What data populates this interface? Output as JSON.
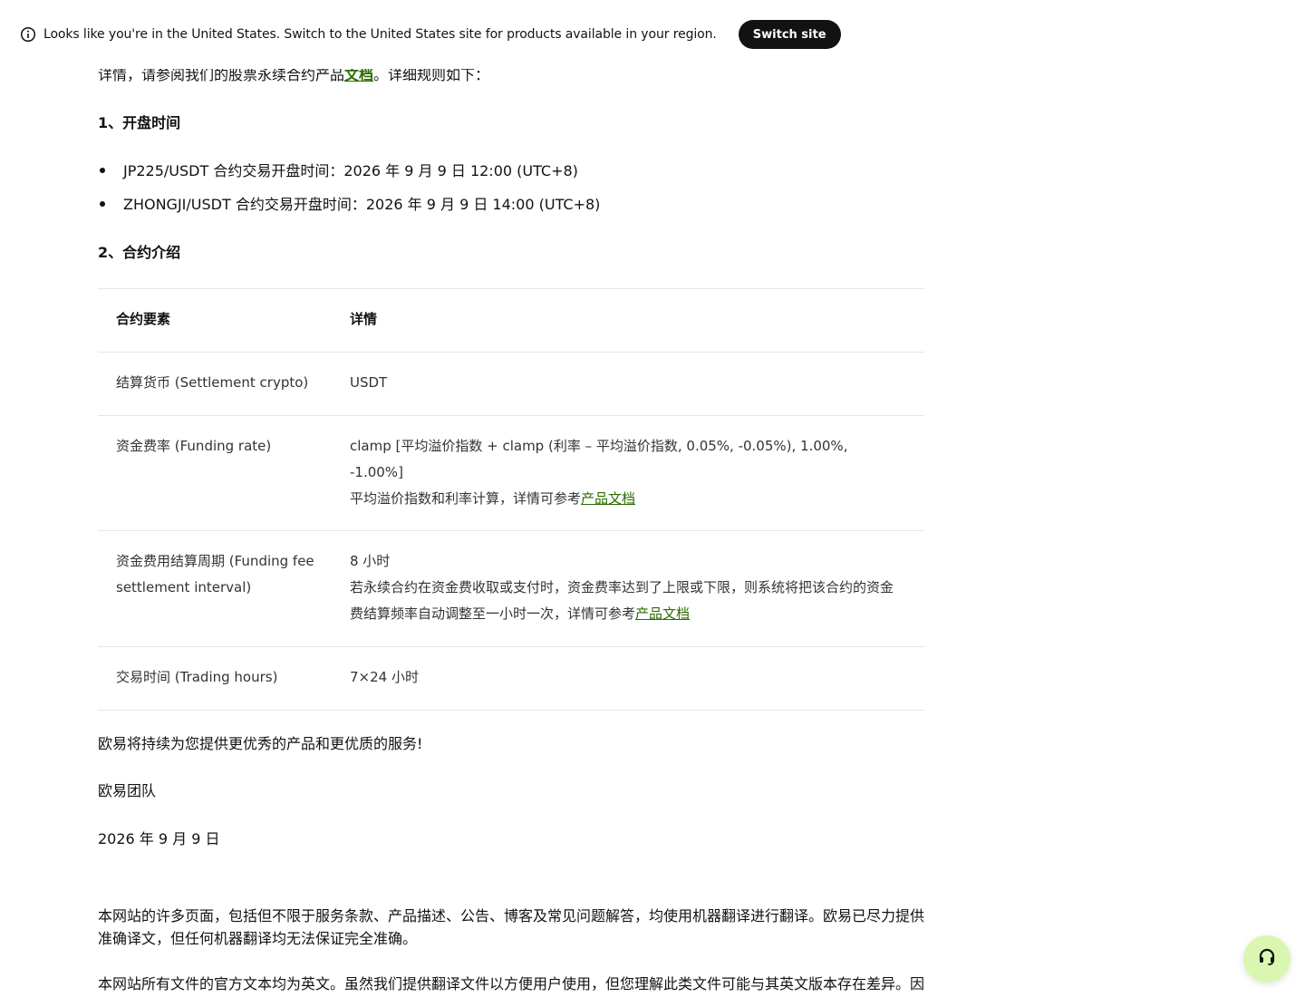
{
  "banner": {
    "message": "Looks like you're in the United States. Switch to the United States site for products available in your region.",
    "switch_label": "Switch site",
    "icon": "info-icon"
  },
  "intro": {
    "prefix": "详情，请参阅我们的股票永续合约产品",
    "link": "文档",
    "suffix": "。详细规则如下："
  },
  "section1": {
    "heading": "1、开盘时间",
    "items": [
      "JP225/USDT 合约交易开盘时间：2026 年 9 月 9 日 12:00 (UTC+8)",
      "ZHONGJI/USDT 合约交易开盘时间：2026 年 9 月 9 日 14:00 (UTC+8)"
    ]
  },
  "section2": {
    "heading": "2、合约介绍"
  },
  "table": {
    "headers": [
      "合约要素",
      "详情"
    ],
    "rows": [
      {
        "label": "结算货币 (Settlement crypto)",
        "line1": "USDT"
      },
      {
        "label": "资金费率 (Funding rate)",
        "line1": "clamp [平均溢价指数 + clamp (利率 – 平均溢价指数, 0.05%, -0.05%), 1.00%, -1.00%]",
        "line2_prefix": "平均溢价指数和利率计算，详情可参考",
        "line2_link": "产品文档"
      },
      {
        "label": "资金费用结算周期 (Funding fee settlement interval)",
        "line1": "8 小时",
        "line2_prefix": "若永续合约在资金费收取或支付时，资金费率达到了上限或下限，则系统将把该合约的资金费结算频率自动调整至一小时一次，详情可参考",
        "line2_link": "产品文档"
      },
      {
        "label": "交易时间 (Trading hours)",
        "line1": "7×24 小时"
      }
    ]
  },
  "closing": {
    "message": "欧易将持续为您提供更优秀的产品和更优质的服务!",
    "team": "欧易团队",
    "date": "2026 年 9 月 9 日"
  },
  "disclaimer": {
    "p1": "本网站的许多页面，包括但不限于服务条款、产品描述、公告、博客及常见问题解答，均使用机器翻译进行翻译。欧易已尽力提供准确译文，但任何机器翻译均无法保证完全准确。",
    "p2": "本网站所有文件的官方文本均为英文。虽然我们提供翻译文件以方便用户使用，但您理解此类文件可能与其英文版本存在差异。因"
  },
  "support": {
    "icon": "headset-icon"
  },
  "colors": {
    "link": "#2c6b00",
    "button_dark": "#121212",
    "support_bg": "#d9f7b0"
  }
}
